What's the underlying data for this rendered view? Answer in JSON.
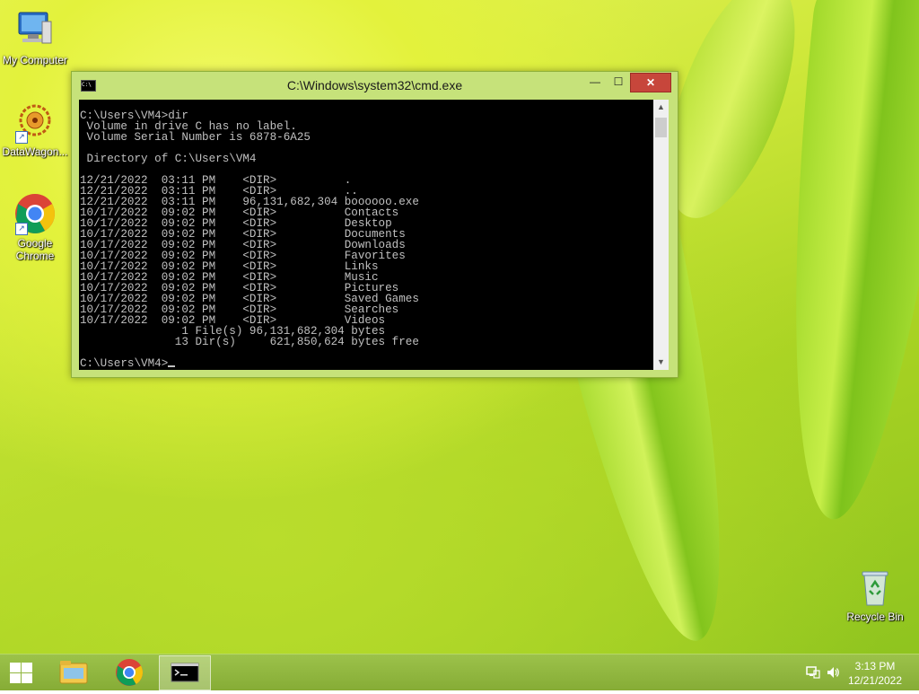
{
  "desktop": {
    "icons": [
      {
        "label": "My Computer",
        "icon": "computer-icon"
      },
      {
        "label": "DataWagon...",
        "icon": "datawagon-icon"
      },
      {
        "label": "Google Chrome",
        "icon": "chrome-icon"
      },
      {
        "label": "Recycle Bin",
        "icon": "recycle-bin-icon"
      }
    ]
  },
  "cmd_window": {
    "title": "C:\\Windows\\system32\\cmd.exe",
    "icon_text": "C:\\",
    "buttons": {
      "minimize": "—",
      "maximize": "☐",
      "close": "✕"
    },
    "output_lines": [
      "C:\\Users\\VM4>dir",
      " Volume in drive C has no label.",
      " Volume Serial Number is 6878-6A25",
      "",
      " Directory of C:\\Users\\VM4",
      "",
      "12/21/2022  03:11 PM    <DIR>          .",
      "12/21/2022  03:11 PM    <DIR>          ..",
      "12/21/2022  03:11 PM    96,131,682,304 boooooo.exe",
      "10/17/2022  09:02 PM    <DIR>          Contacts",
      "10/17/2022  09:02 PM    <DIR>          Desktop",
      "10/17/2022  09:02 PM    <DIR>          Documents",
      "10/17/2022  09:02 PM    <DIR>          Downloads",
      "10/17/2022  09:02 PM    <DIR>          Favorites",
      "10/17/2022  09:02 PM    <DIR>          Links",
      "10/17/2022  09:02 PM    <DIR>          Music",
      "10/17/2022  09:02 PM    <DIR>          Pictures",
      "10/17/2022  09:02 PM    <DIR>          Saved Games",
      "10/17/2022  09:02 PM    <DIR>          Searches",
      "10/17/2022  09:02 PM    <DIR>          Videos",
      "               1 File(s) 96,131,682,304 bytes",
      "              13 Dir(s)     621,850,624 bytes free",
      ""
    ],
    "prompt": "C:\\Users\\VM4>"
  },
  "taskbar": {
    "items": [
      "windows-start-icon",
      "file-explorer-icon",
      "chrome-icon",
      "cmd-icon"
    ],
    "tray_icons": [
      "network-icon",
      "volume-icon"
    ],
    "clock_time": "3:13 PM",
    "clock_date": "12/21/2022"
  },
  "colors": {
    "close_button": "#c7463b",
    "console_bg": "#000000",
    "console_fg": "#c0c0c0",
    "window_frame": "#c6e27a",
    "taskbar": "#8fb33e"
  }
}
